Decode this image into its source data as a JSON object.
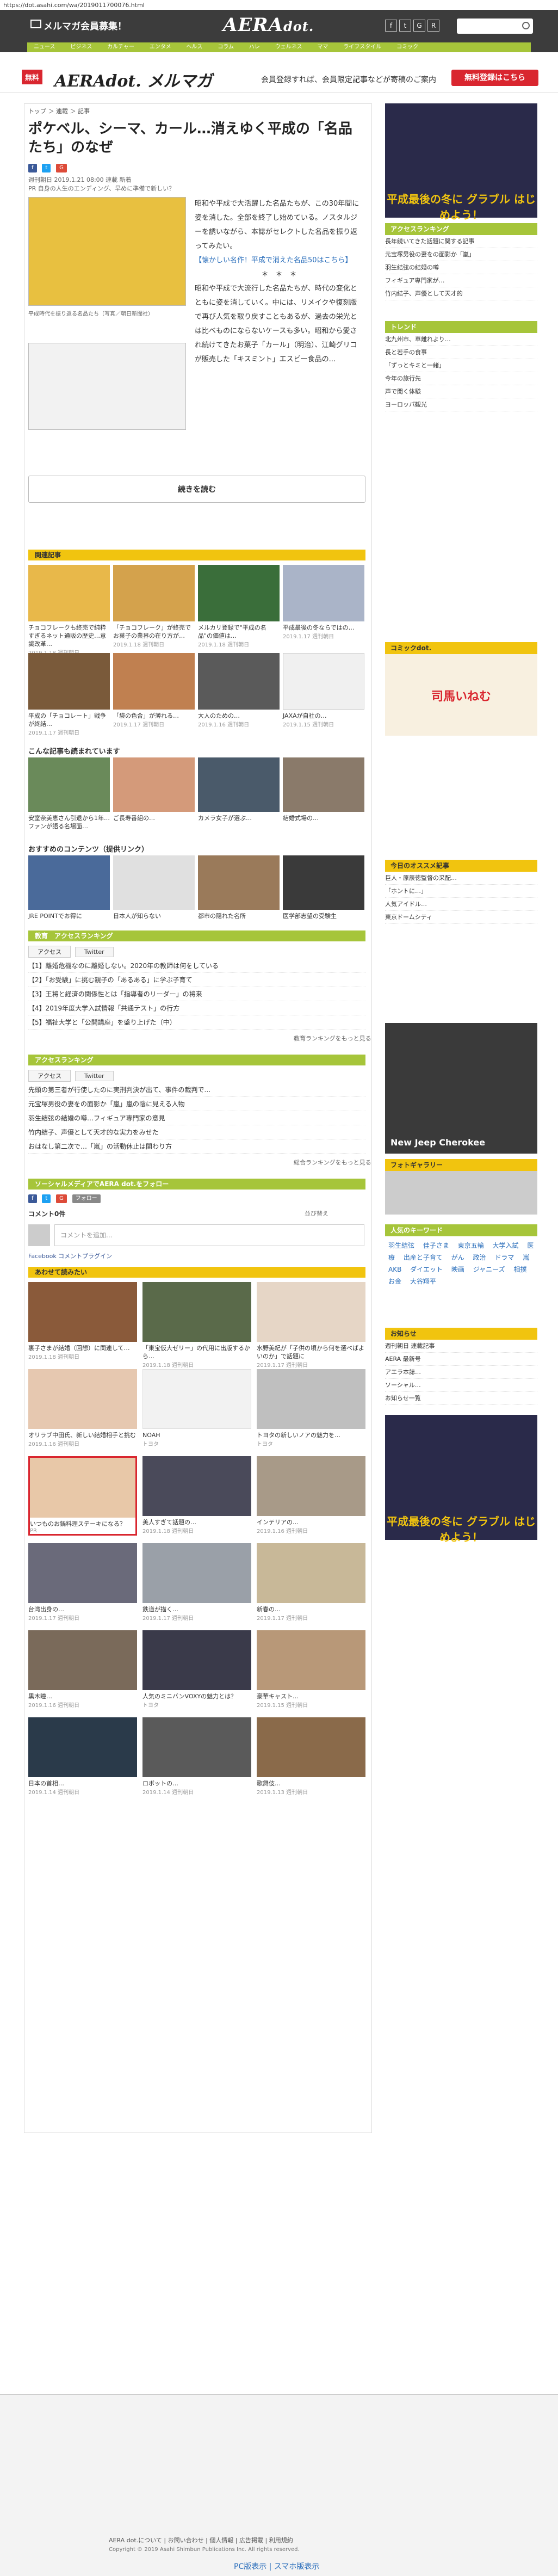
{
  "url": "https://dot.asahi.com/wa/2019011700076.html",
  "header": {
    "member_link": "メルマガ会員募集！",
    "logo_main": "AERA",
    "logo_sub": "dot.",
    "nav": [
      "ニュース",
      "ビジネス",
      "カルチャー",
      "エンタメ",
      "ヘルス",
      "コラム",
      "ハレ",
      "ウェルネス",
      "ママ",
      "ライフスタイル",
      "コミック"
    ]
  },
  "member_band": {
    "free_badge": "無料",
    "brand": "AERAdot. メルマガ",
    "text": "会員登録すれば、会員限定記事などが寄稿のご案内",
    "register_button": "無料登録はこちら"
  },
  "article": {
    "breadcrumb": "トップ ＞ 連載 ＞ 記事",
    "title": "ポケベル、シーマ、カール…消えゆく平成の「名品たち」のなぜ",
    "date": "週刊朝日 2019.1.21 08:00 連載 新着",
    "author_line": "PR 自身の人生のエンディング、早めに準備で新しい？",
    "image_caption": "平成時代を振り返る名品たち（写真／朝日新聞社）",
    "body": [
      "昭和や平成で大活躍した名品たちが、この30年間に姿を消した。全部を終了し始めている。ノスタルジーを誘いながら、本誌がセレクトした名品を振り返ってみたい。",
      "【懐かしい名作！平成で消えた名品50はこちら】",
      "＊　＊　＊",
      "昭和や平成で大流行した名品たちが、時代の変化とともに姿を消していく。中には、リメイクや復刻版で再び人気を取り戻すこともあるが、過去の栄光とは比べものにならないケースも多い。昭和から愛され続けてきたお菓子「カール」（明治）、江崎グリコが販売した「キスミント」エスビー食品の..."
    ],
    "continue_button": "続きを読む",
    "rank_tag": "関連記事"
  },
  "related_header": "関連記事",
  "related_grid": [
    {
      "caption": "チョコフレークも終売で純粋すぎるネット通販の歴史…意識改革…",
      "source": "2019.1.18 週刊朝日"
    },
    {
      "caption": "「チョコフレーク」が終売でお菓子の業界の在り方が…",
      "source": "2019.1.18 週刊朝日"
    },
    {
      "caption": "メルカリ登録で\"平成の名品\"の価値は…",
      "source": "2019.1.18 週刊朝日"
    },
    {
      "caption": "平成最後の冬ならではの…",
      "source": "2019.1.17 週刊朝日"
    },
    {
      "caption": "平成の「チョコレート」戦争が終結…",
      "source": "2019.1.17 週刊朝日"
    },
    {
      "caption": "「袋の色合」が薄れる…",
      "source": "2019.1.17 週刊朝日"
    },
    {
      "caption": "大人のための…",
      "source": "2019.1.16 週刊朝日"
    },
    {
      "caption": "JAXAが自社の…",
      "source": "2019.1.15 週刊朝日"
    }
  ],
  "recommend_header": "こんな記事も読まれています",
  "recommend": [
    {
      "caption": "安室奈美恵さん引退から1年…ファンが語る名場面…"
    },
    {
      "caption": "ご長寿番組の…"
    },
    {
      "caption": "カメラ女子が選ぶ…"
    },
    {
      "caption": "結婚式場の…"
    }
  ],
  "content_header": "おすすめのコンテンツ（提供リンク）",
  "content": [
    {
      "caption": "JRE POINTでお得に"
    },
    {
      "caption": "日本人が知らない"
    },
    {
      "caption": "都市の隠れた名所"
    },
    {
      "caption": "医学部志望の受験生"
    }
  ],
  "ranking1": {
    "header": "教育　アクセスランキング",
    "tabs": [
      "アクセス",
      "Twitter"
    ],
    "rows": [
      "【1】離婚危機なのに離婚しない。2020年の教師は何をしている",
      "【2】「お受験」に挑む親子の「あるある」に学ぶ子育て",
      "【3】王将と経済の関係性とは「指導者のリーダー」の将来",
      "【4】2019年度大学入試情報「共通テスト」の行方",
      "【5】福祉大学と「公開講座」を盛り上げた（中）"
    ],
    "more": "教育ランキングをもっと見る"
  },
  "ranking2": {
    "header": "アクセスランキング",
    "tabs": [
      "アクセス",
      "Twitter"
    ],
    "rows": [
      "先頭の第三者が行使したのに実刑判決が出て、事件の裁判で…",
      "元宝塚男役の妻をの面影か「嵐」嵐の陰に見える人物",
      "羽生結弦の結婚の噂…フィギュア専門家の意見",
      "竹内結子、声優として天才的な実力をみせた",
      "おはなし第二次で…「嵐」の活動休止は関わり方"
    ],
    "more": "総合ランキングをもっと見る"
  },
  "social": {
    "header": "ソーシャルメディアでAERA dot.をフォロー",
    "follow_label": "フォロー"
  },
  "comments": {
    "count": "コメント0件",
    "sort_label": "並び替え",
    "placeholder": "コメントを追加...",
    "plugin": "Facebook コメントプラグイン"
  },
  "promo_header": "あわせて読みたい",
  "promo": [
    {
      "caption": "裏子さまが結婚（回想）に関連して…",
      "source": "2019.1.18 週刊朝日"
    },
    {
      "caption": "「東宝仮大ゼリー」の代用に出版するから…",
      "source": "2019.1.18 週刊朝日"
    },
    {
      "caption": "水野美紀が「子供の頃から何を選べばよいのか」で話題に",
      "source": "2019.1.17 週刊朝日"
    },
    {
      "caption": "オリラブ中田氏、新しい結婚相手と挑む",
      "source": "2019.1.16 週刊朝日"
    },
    {
      "caption": "NOAH",
      "source": "トヨタ"
    },
    {
      "caption": "トヨタの新しいノアの魅力を…",
      "source": "トヨタ"
    },
    {
      "caption": "いつものお鍋料理ステーキになる？",
      "source": "PR"
    },
    {
      "caption": "美人すぎて話題の…",
      "source": "2019.1.18 週刊朝日"
    },
    {
      "caption": "インテリアの…",
      "source": "2019.1.16 週刊朝日"
    },
    {
      "caption": "台湾出身の…",
      "source": "2019.1.17 週刊朝日"
    },
    {
      "caption": "鉄道が描く…",
      "source": "2019.1.17 週刊朝日"
    },
    {
      "caption": "新春の…",
      "source": "2019.1.17 週刊朝日"
    },
    {
      "caption": "黒木瞳…",
      "source": "2019.1.16 週刊朝日"
    },
    {
      "caption": "人気のミニバンVOXYの魅力とは？",
      "source": "トヨタ"
    },
    {
      "caption": "豪華キャスト…",
      "source": "2019.1.15 週刊朝日"
    },
    {
      "caption": "日本の首相…",
      "source": "2019.1.14 週刊朝日"
    },
    {
      "caption": "ロボットの…",
      "source": "2019.1.14 週刊朝日"
    },
    {
      "caption": "歌舞伎…",
      "source": "2019.1.13 週刊朝日"
    }
  ],
  "sidebar": {
    "access_ranking_header": "アクセスランキング",
    "access_rows": [
      "長年続いてきた話題に関する記事",
      "元宝塚男役の妻をの面影か「嵐」",
      "羽生結弦の結婚の噂",
      "フィギュア専門家が…",
      "竹内結子、声優として天才的"
    ],
    "trend_header": "トレンド",
    "trend_rows": [
      "北九州市、車離れより…",
      "長と若手の食事",
      "「ずっとキミと一緒」",
      "今年の旅行先",
      "声で聞く体験",
      "ヨーロッパ観光"
    ],
    "comic_header": "コミックdot.",
    "comic_title": "司馬いねむ",
    "todays_header": "今日のオススメ記事",
    "todays_rows": [
      "巨人・原辰徳監督の采配…",
      "「ホントに…」",
      "人気アイドル…",
      "東京ドームシティ"
    ],
    "car_ad": "New Jeep Cherokee",
    "photo_header": "フォトギャラリー",
    "keyword_header": "人気のキーワード",
    "keywords": [
      "羽生結弦",
      "佳子さま",
      "東京五輪",
      "大学入試",
      "医療",
      "出産と子育て",
      "がん",
      "政治",
      "ドラマ",
      "嵐",
      "AKB",
      "ダイエット",
      "映画",
      "ジャニーズ",
      "相撲",
      "お金",
      "大谷翔平"
    ],
    "notice_header": "お知らせ",
    "notice_rows": [
      "週刊朝日 連載記事",
      "AERA 最新号",
      "アエラ本誌…",
      "ソーシャル…",
      "お知らせ一覧"
    ],
    "game_ad": "平成最後の冬に グラブル はじめよう！"
  },
  "footer": {
    "links": [
      "AERA dot.について",
      "お問い合わせ",
      "個人情報",
      "広告掲載",
      "利用規約"
    ],
    "copyright": "Copyright © 2019 Asahi Shimbun Publications Inc. All rights reserved.",
    "pc_sp": "PC版表示 | スマホ版表示"
  }
}
